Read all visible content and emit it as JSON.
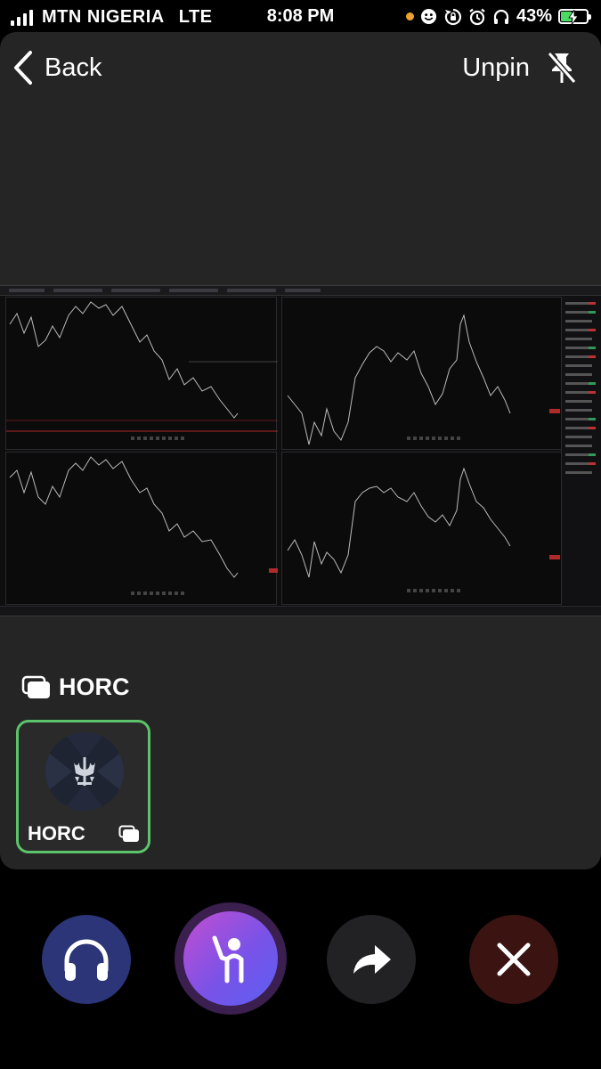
{
  "status_bar": {
    "carrier": "MTN NIGERIA",
    "network": "LTE",
    "time": "8:08 PM",
    "battery_percent": "43%",
    "battery_level": 0.43,
    "icons": [
      "signal-icon",
      "orange-dot",
      "smiley-icon",
      "rotation-lock-icon",
      "alarm-icon",
      "headphones-icon",
      "battery-charging-icon"
    ]
  },
  "header": {
    "back_label": "Back",
    "unpin_label": "Unpin"
  },
  "room": {
    "title": "HORC",
    "speaker": {
      "name": "HORC",
      "active_border_color": "#5cc36a"
    }
  },
  "controls": {
    "listen": "headphones-icon",
    "raise_hand": "raise-hand-icon",
    "share": "share-arrow-icon",
    "leave": "close-icon"
  },
  "colors": {
    "card_bg": "#252525",
    "listen_bg": "#2c3577",
    "hand_gradient_start": "#c24fd1",
    "hand_gradient_end": "#5a60f0",
    "leave_bg": "#3b1412"
  }
}
